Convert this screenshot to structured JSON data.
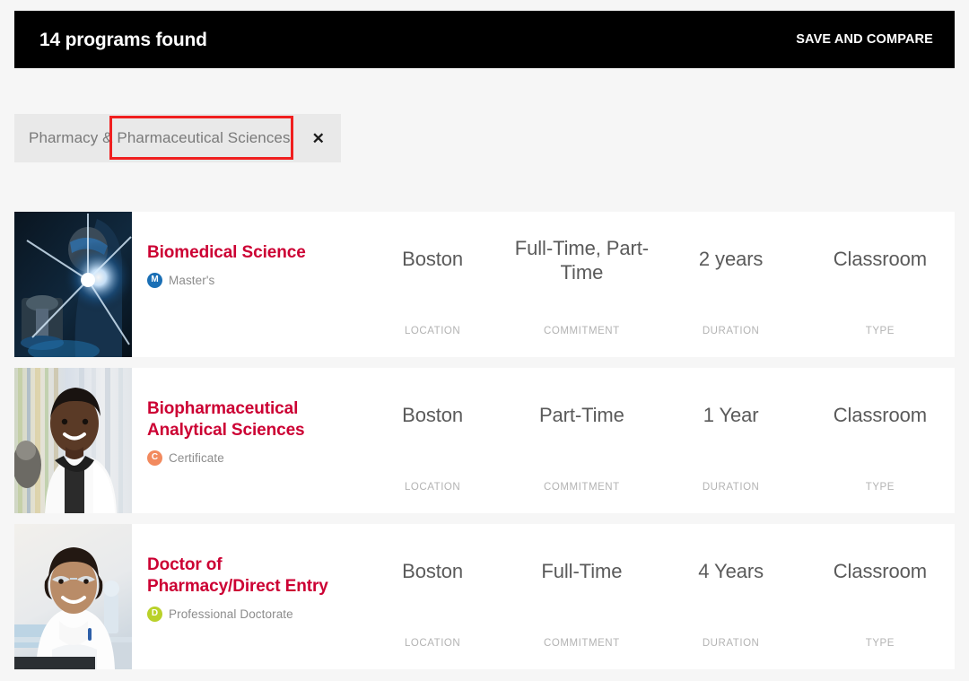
{
  "header": {
    "results_count_text": "14 programs found",
    "save_compare_label": "SAVE AND COMPARE"
  },
  "filters": {
    "chips": [
      {
        "label": "Pharmacy & Pharmaceutical Sciences",
        "remove_glyph": "✕"
      }
    ]
  },
  "annotation": {
    "color": "#f01f1f",
    "target": "Pharmaceutical Sciences"
  },
  "columns": {
    "location_label": "LOCATION",
    "commitment_label": "COMMITMENT",
    "duration_label": "DURATION",
    "type_label": "TYPE"
  },
  "colors": {
    "title_red": "#cc0033",
    "header_black": "#000000",
    "page_background": "#f6f6f6",
    "card_background": "#ffffff",
    "chip_background": "#e9e9e9",
    "masters_badge": "#1a6fb5",
    "certificate_badge": "#f28a5e",
    "doctorate_badge": "#b9d12a"
  },
  "results": [
    {
      "title": "Biomedical Science",
      "degree_badge_letter": "M",
      "degree_label": "Master's",
      "badge_color": "#1a6fb5",
      "location": "Boston",
      "commitment": "Full-Time, Part-Time",
      "duration": "2 years",
      "type": "Classroom",
      "thumb_alt": "researcher-at-microscope-photo"
    },
    {
      "title": "Biopharmaceutical Analytical Sciences",
      "degree_badge_letter": "C",
      "degree_label": "Certificate",
      "badge_color": "#f28a5e",
      "location": "Boston",
      "commitment": "Part-Time",
      "duration": "1 Year",
      "type": "Classroom",
      "thumb_alt": "student-in-lab-coat-photo"
    },
    {
      "title": "Doctor of Pharmacy/Direct Entry",
      "degree_badge_letter": "D",
      "degree_label": "Professional Doctorate",
      "badge_color": "#b9d12a",
      "location": "Boston",
      "commitment": "Full-Time",
      "duration": "4 Years",
      "type": "Classroom",
      "thumb_alt": "pharmacist-in-lab-photo"
    }
  ]
}
